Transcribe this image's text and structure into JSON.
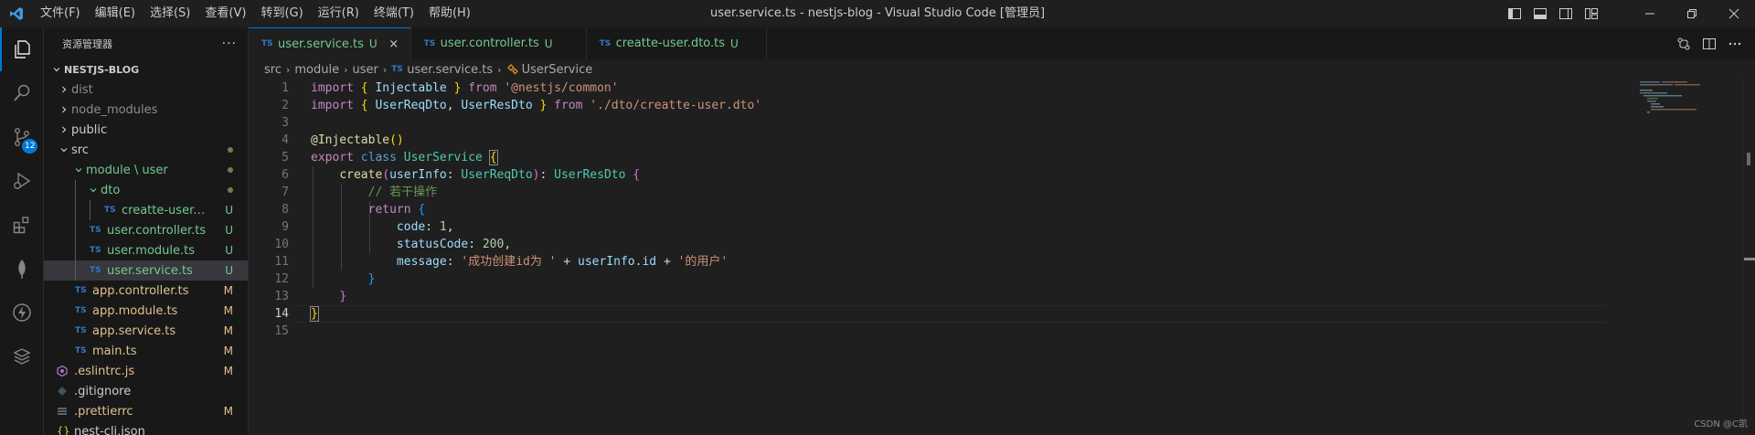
{
  "titlebar": {
    "title": "user.service.ts - nestjs-blog - Visual Studio Code [管理员]",
    "menu": [
      "文件(F)",
      "编辑(E)",
      "选择(S)",
      "查看(V)",
      "转到(G)",
      "运行(R)",
      "终端(T)",
      "帮助(H)"
    ]
  },
  "activity": {
    "items": [
      "explorer-icon",
      "search-icon",
      "source-control-icon",
      "run-debug-icon",
      "extensions-icon",
      "mongodb-leaf-icon",
      "thunder-client-icon",
      "database-icon"
    ],
    "scm_badge": "12",
    "accent": "#0078d4"
  },
  "sidebar": {
    "header": "资源管理器",
    "more": "···",
    "project": "NESTJS-BLOG",
    "tree": [
      {
        "label": "dist",
        "status": ""
      },
      {
        "label": "node_modules",
        "status": ""
      },
      {
        "label": "public",
        "status": ""
      },
      {
        "label": "src",
        "status": "dot"
      },
      {
        "label": "module \\ user",
        "status": "dot"
      },
      {
        "label": "dto",
        "status": "dot"
      },
      {
        "label": "creatte-user.dt...",
        "status": "U"
      },
      {
        "label": "user.controller.ts",
        "status": "U"
      },
      {
        "label": "user.module.ts",
        "status": "U"
      },
      {
        "label": "user.service.ts",
        "status": "U"
      },
      {
        "label": "app.controller.ts",
        "status": "M"
      },
      {
        "label": "app.module.ts",
        "status": "M"
      },
      {
        "label": "app.service.ts",
        "status": "M"
      },
      {
        "label": "main.ts",
        "status": "M"
      },
      {
        "label": ".eslintrc.js",
        "status": "M"
      },
      {
        "label": ".gitignore",
        "status": ""
      },
      {
        "label": ".prettierrc",
        "status": "M"
      },
      {
        "label": "nest-cli.json",
        "status": ""
      }
    ],
    "ts_tag": "TS",
    "colors": {
      "untracked": "#73c991",
      "modified": "#e2c08d"
    }
  },
  "tabs": [
    {
      "label": "user.service.ts",
      "status": "U",
      "active": true,
      "close": "×"
    },
    {
      "label": "user.controller.ts",
      "status": "U",
      "active": false
    },
    {
      "label": "creatte-user.dto.ts",
      "status": "U",
      "active": false
    }
  ],
  "breadcrumb": [
    "src",
    "module",
    "user",
    "user.service.ts",
    "UserService"
  ],
  "editor": {
    "line_numbers": [
      "1",
      "2",
      "3",
      "4",
      "5",
      "6",
      "7",
      "8",
      "9",
      "10",
      "11",
      "12",
      "13",
      "14",
      "15"
    ],
    "current_line": "14"
  },
  "watermark": "CSDN @C凯"
}
